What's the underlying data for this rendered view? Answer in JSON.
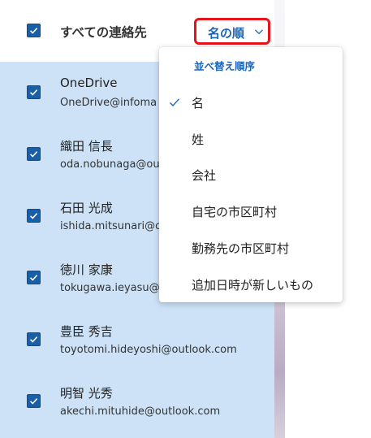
{
  "header": {
    "title": "すべての連絡先",
    "sort_label": "名の順"
  },
  "contacts": [
    {
      "name": "OneDrive",
      "email": "OneDrive@infoma"
    },
    {
      "name": "織田 信長",
      "email": "oda.nobunaga@ou"
    },
    {
      "name": "石田 光成",
      "email": "ishida.mitsunari@o"
    },
    {
      "name": "徳川 家康",
      "email": "tokugawa.ieyasu@o"
    },
    {
      "name": "豊臣 秀吉",
      "email": "toyotomi.hideyoshi@outlook.com"
    },
    {
      "name": "明智 光秀",
      "email": "akechi.mituhide@outlook.com"
    }
  ],
  "sort_menu": {
    "heading": "並べ替え順序",
    "items": [
      {
        "label": "名",
        "selected": true
      },
      {
        "label": "姓",
        "selected": false
      },
      {
        "label": "会社",
        "selected": false
      },
      {
        "label": "自宅の市区町村",
        "selected": false
      },
      {
        "label": "勤務先の市区町村",
        "selected": false
      },
      {
        "label": "追加日時が新しいもの",
        "selected": false
      }
    ]
  },
  "colors": {
    "accent": "#1b65b8",
    "checkbox": "#1a5ea8",
    "selection_bg": "#cde2f7",
    "highlight_border": "#e8141c"
  }
}
